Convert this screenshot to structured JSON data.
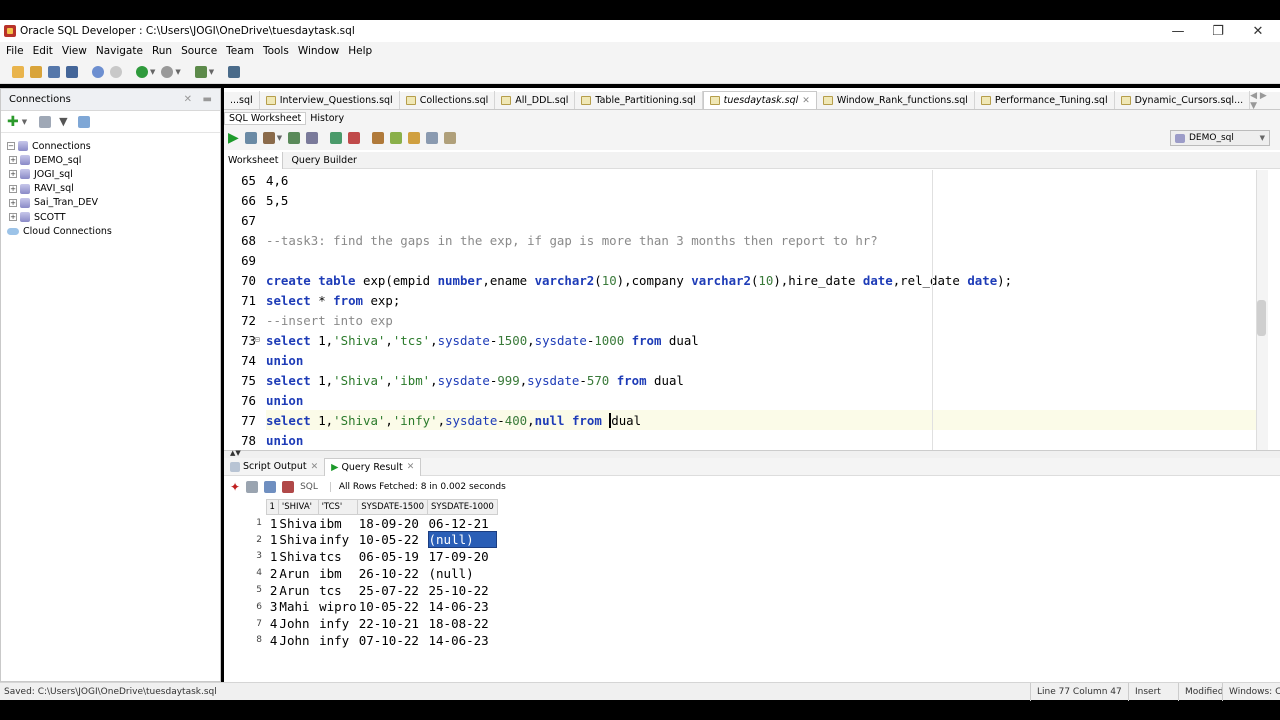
{
  "window": {
    "title": "Oracle SQL Developer : C:\\Users\\JOGI\\OneDrive\\tuesdaytask.sql"
  },
  "menu": [
    "File",
    "Edit",
    "View",
    "Navigate",
    "Run",
    "Source",
    "Team",
    "Tools",
    "Window",
    "Help"
  ],
  "connections_panel": {
    "header": "Connections",
    "root": "Connections",
    "items": [
      "DEMO_sql",
      "JOGI_sql",
      "RAVI_sql",
      "Sai_Tran_DEV",
      "SCOTT"
    ],
    "cloud": "Cloud Connections"
  },
  "doc_tabs": [
    {
      "label": "...sql",
      "active": false
    },
    {
      "label": "Interview_Questions.sql",
      "active": false
    },
    {
      "label": "Collections.sql",
      "active": false
    },
    {
      "label": "All_DDL.sql",
      "active": false
    },
    {
      "label": "Table_Partitioning.sql",
      "active": false
    },
    {
      "label": "tuesdaytask.sql",
      "active": true
    },
    {
      "label": "Window_Rank_functions.sql",
      "active": false
    },
    {
      "label": "Performance_Tuning.sql",
      "active": false
    },
    {
      "label": "Dynamic_Cursors.sql...",
      "active": false
    }
  ],
  "sub_tabs": [
    "SQL Worksheet",
    "History"
  ],
  "connection_selector": "DEMO_sql",
  "worksheet_tabs": [
    "Worksheet",
    "Query Builder"
  ],
  "editor": {
    "line_numbers": [
      "65",
      "66",
      "67",
      "68",
      "69",
      "70",
      "71",
      "72",
      "73",
      "74",
      "75",
      "76",
      "77",
      "78"
    ]
  },
  "output_tabs": [
    "Script Output",
    "Query Result"
  ],
  "result_toolbar": {
    "sql_label": "SQL",
    "status": "All Rows Fetched: 8 in 0.002 seconds"
  },
  "result_grid": {
    "columns": [
      "1",
      "'SHIVA'",
      "'TCS'",
      "SYSDATE-1500",
      "SYSDATE-1000"
    ],
    "rows": [
      [
        "1",
        "1",
        "Shiva",
        "ibm",
        "18-09-20",
        "06-12-21"
      ],
      [
        "2",
        "1",
        "Shiva",
        "infy",
        "10-05-22",
        "(null)"
      ],
      [
        "3",
        "1",
        "Shiva",
        "tcs",
        "06-05-19",
        "17-09-20"
      ],
      [
        "4",
        "2",
        "Arun",
        "ibm",
        "26-10-22",
        "(null)"
      ],
      [
        "5",
        "2",
        "Arun",
        "tcs",
        "25-07-22",
        "25-10-22"
      ],
      [
        "6",
        "3",
        "Mahi",
        "wipro",
        "10-05-22",
        "14-06-23"
      ],
      [
        "7",
        "4",
        "John",
        "infy",
        "22-10-21",
        "18-08-22"
      ],
      [
        "8",
        "4",
        "John",
        "infy",
        "07-10-22",
        "14-06-23"
      ]
    ]
  },
  "status_bar": {
    "saved": "Saved: C:\\Users\\JOGI\\OneDrive\\tuesdaytask.sql",
    "position": "Line 77 Column 47",
    "mode": "Insert",
    "modified": "Modified",
    "os": "Windows: CR"
  },
  "colors": {
    "keyword": "#1d3bb7",
    "comment": "#8a8a8a",
    "string": "#2a7a2a",
    "selection": "#2a5eb6"
  }
}
